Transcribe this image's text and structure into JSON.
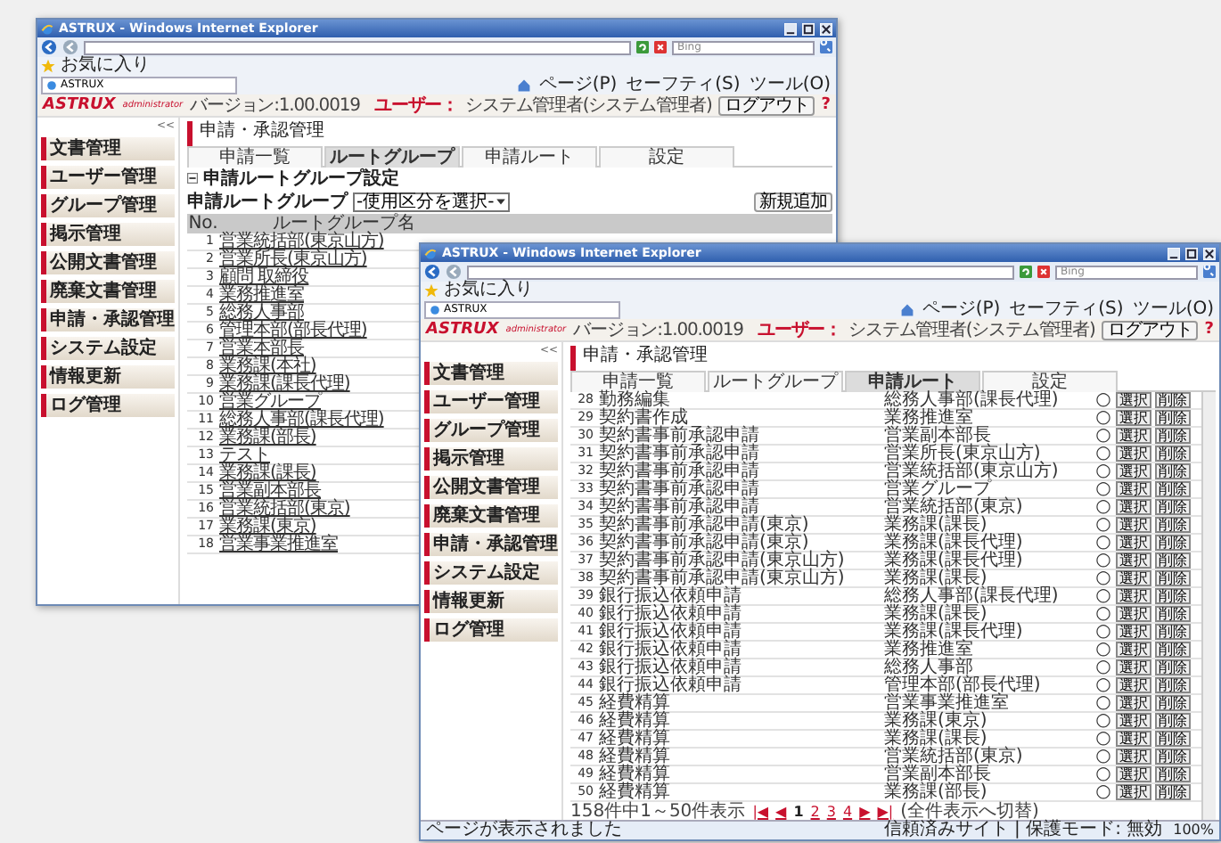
{
  "windows": [
    {
      "kind": "groups",
      "title": "ASTRUX - Windows Internet Explorer",
      "search_placeholder": "Bing",
      "favorites": "お気に入り",
      "tab": "ASTRUX",
      "toolbar": [
        "ページ(P)",
        "セーフティ(S)",
        "ツール(O)"
      ],
      "app": {
        "logo": "ASTRUX",
        "logo_sub": "administrator",
        "version": "バージョン:1.00.0019",
        "user_label": "ユーザー：",
        "user": "システム管理者(システム管理者)",
        "logout": "ログアウト",
        "help": "?",
        "collapse": "<<",
        "menu": [
          "文書管理",
          "ユーザー管理",
          "グループ管理",
          "掲示管理",
          "公開文書管理",
          "廃棄文書管理",
          "申請・承認管理",
          "システム設定",
          "情報更新",
          "ログ管理"
        ],
        "page_title": "申請・承認管理",
        "tabs": [
          {
            "label": "申請一覧",
            "selected": false
          },
          {
            "label": "ルートグループ",
            "selected": true
          },
          {
            "label": "申請ルート",
            "selected": false
          },
          {
            "label": "設定",
            "selected": false
          }
        ]
      },
      "section_title": "申請ルートグループ設定",
      "filter_label": "申請ルートグループ",
      "filter_value": "-使用区分を選択-",
      "add_button": "新規追加",
      "columns": [
        "No.",
        "ルートグループ名"
      ],
      "rows": [
        {
          "no": "1",
          "name": "営業統括部(東京山方)"
        },
        {
          "no": "2",
          "name": "営業所長(東京山方)"
        },
        {
          "no": "3",
          "name": "顧問 取締役"
        },
        {
          "no": "4",
          "name": "業務推進室"
        },
        {
          "no": "5",
          "name": "総務人事部"
        },
        {
          "no": "6",
          "name": "管理本部(部長代理)"
        },
        {
          "no": "7",
          "name": "営業本部長"
        },
        {
          "no": "8",
          "name": "業務課(本社)"
        },
        {
          "no": "9",
          "name": "業務課(課長代理)"
        },
        {
          "no": "10",
          "name": "営業グループ"
        },
        {
          "no": "11",
          "name": "総務人事部(課長代理)"
        },
        {
          "no": "12",
          "name": "業務課(部長)"
        },
        {
          "no": "13",
          "name": "テスト"
        },
        {
          "no": "14",
          "name": "業務課(課長)"
        },
        {
          "no": "15",
          "name": "営業副本部長"
        },
        {
          "no": "16",
          "name": "営業統括部(東京)"
        },
        {
          "no": "17",
          "name": "業務課(東京)"
        },
        {
          "no": "18",
          "name": "営業事業推進室"
        }
      ]
    },
    {
      "kind": "routes",
      "title": "ASTRUX - Windows Internet Explorer",
      "search_placeholder": "Bing",
      "favorites": "お気に入り",
      "tab": "ASTRUX",
      "toolbar": [
        "ページ(P)",
        "セーフティ(S)",
        "ツール(O)"
      ],
      "app": {
        "logo": "ASTRUX",
        "logo_sub": "administrator",
        "version": "バージョン:1.00.0019",
        "user_label": "ユーザー：",
        "user": "システム管理者(システム管理者)",
        "logout": "ログアウト",
        "help": "?",
        "collapse": "<<",
        "menu": [
          "文書管理",
          "ユーザー管理",
          "グループ管理",
          "掲示管理",
          "公開文書管理",
          "廃棄文書管理",
          "申請・承認管理",
          "システム設定",
          "情報更新",
          "ログ管理"
        ],
        "page_title": "申請・承認管理",
        "tabs": [
          {
            "label": "申請一覧",
            "selected": false
          },
          {
            "label": "ルートグループ",
            "selected": false
          },
          {
            "label": "申請ルート",
            "selected": true
          },
          {
            "label": "設定",
            "selected": false
          }
        ]
      },
      "rows": [
        {
          "no": "28",
          "name": "勤務編集",
          "route": "総務人事部(課長代理)",
          "active": "○",
          "select": "選択",
          "delete": "削除"
        },
        {
          "no": "29",
          "name": "契約書作成",
          "route": "業務推進室",
          "active": "○",
          "select": "選択",
          "delete": "削除"
        },
        {
          "no": "30",
          "name": "契約書事前承認申請",
          "route": "営業副本部長",
          "active": "○",
          "select": "選択",
          "delete": "削除"
        },
        {
          "no": "31",
          "name": "契約書事前承認申請",
          "route": "営業所長(東京山方)",
          "active": "○",
          "select": "選択",
          "delete": "削除"
        },
        {
          "no": "32",
          "name": "契約書事前承認申請",
          "route": "営業統括部(東京山方)",
          "active": "○",
          "select": "選択",
          "delete": "削除"
        },
        {
          "no": "33",
          "name": "契約書事前承認申請",
          "route": "営業グループ",
          "active": "○",
          "select": "選択",
          "delete": "削除"
        },
        {
          "no": "34",
          "name": "契約書事前承認申請",
          "route": "営業統括部(東京)",
          "active": "○",
          "select": "選択",
          "delete": "削除"
        },
        {
          "no": "35",
          "name": "契約書事前承認申請(東京)",
          "route": "業務課(課長)",
          "active": "○",
          "select": "選択",
          "delete": "削除"
        },
        {
          "no": "36",
          "name": "契約書事前承認申請(東京)",
          "route": "業務課(課長代理)",
          "active": "○",
          "select": "選択",
          "delete": "削除"
        },
        {
          "no": "37",
          "name": "契約書事前承認申請(東京山方)",
          "route": "業務課(課長代理)",
          "active": "○",
          "select": "選択",
          "delete": "削除"
        },
        {
          "no": "38",
          "name": "契約書事前承認申請(東京山方)",
          "route": "業務課(課長)",
          "active": "○",
          "select": "選択",
          "delete": "削除"
        },
        {
          "no": "39",
          "name": "銀行振込依頼申請",
          "route": "総務人事部(課長代理)",
          "active": "○",
          "select": "選択",
          "delete": "削除"
        },
        {
          "no": "40",
          "name": "銀行振込依頼申請",
          "route": "業務課(課長)",
          "active": "○",
          "select": "選択",
          "delete": "削除"
        },
        {
          "no": "41",
          "name": "銀行振込依頼申請",
          "route": "業務課(課長代理)",
          "active": "○",
          "select": "選択",
          "delete": "削除"
        },
        {
          "no": "42",
          "name": "銀行振込依頼申請",
          "route": "業務推進室",
          "active": "○",
          "select": "選択",
          "delete": "削除"
        },
        {
          "no": "43",
          "name": "銀行振込依頼申請",
          "route": "総務人事部",
          "active": "○",
          "select": "選択",
          "delete": "削除"
        },
        {
          "no": "44",
          "name": "銀行振込依頼申請",
          "route": "管理本部(部長代理)",
          "active": "○",
          "select": "選択",
          "delete": "削除"
        },
        {
          "no": "45",
          "name": "経費精算",
          "route": "営業事業推進室",
          "active": "○",
          "select": "選択",
          "delete": "削除"
        },
        {
          "no": "46",
          "name": "経費精算",
          "route": "業務課(東京)",
          "active": "○",
          "select": "選択",
          "delete": "削除"
        },
        {
          "no": "47",
          "name": "経費精算",
          "route": "業務課(課長)",
          "active": "○",
          "select": "選択",
          "delete": "削除"
        },
        {
          "no": "48",
          "name": "経費精算",
          "route": "営業統括部(東京)",
          "active": "○",
          "select": "選択",
          "delete": "削除"
        },
        {
          "no": "49",
          "name": "経費精算",
          "route": "営業副本部長",
          "active": "○",
          "select": "選択",
          "delete": "削除"
        },
        {
          "no": "50",
          "name": "経費精算",
          "route": "業務課(部長)",
          "active": "○",
          "select": "選択",
          "delete": "削除"
        }
      ],
      "pager": {
        "summary": "158件中1～50件表示",
        "first": "|◀",
        "prev": "◀",
        "pages": [
          {
            "label": "1",
            "selected": true
          },
          {
            "label": "2",
            "selected": false
          },
          {
            "label": "3",
            "selected": false
          },
          {
            "label": "4",
            "selected": false
          }
        ],
        "next": "▶",
        "last": "▶|",
        "toggle": "(全件表示へ切替)"
      },
      "status": {
        "text": "ページが表示されました",
        "zone": "信頼済みサイト | 保護モード: 無効",
        "zoom": "100%"
      }
    }
  ]
}
